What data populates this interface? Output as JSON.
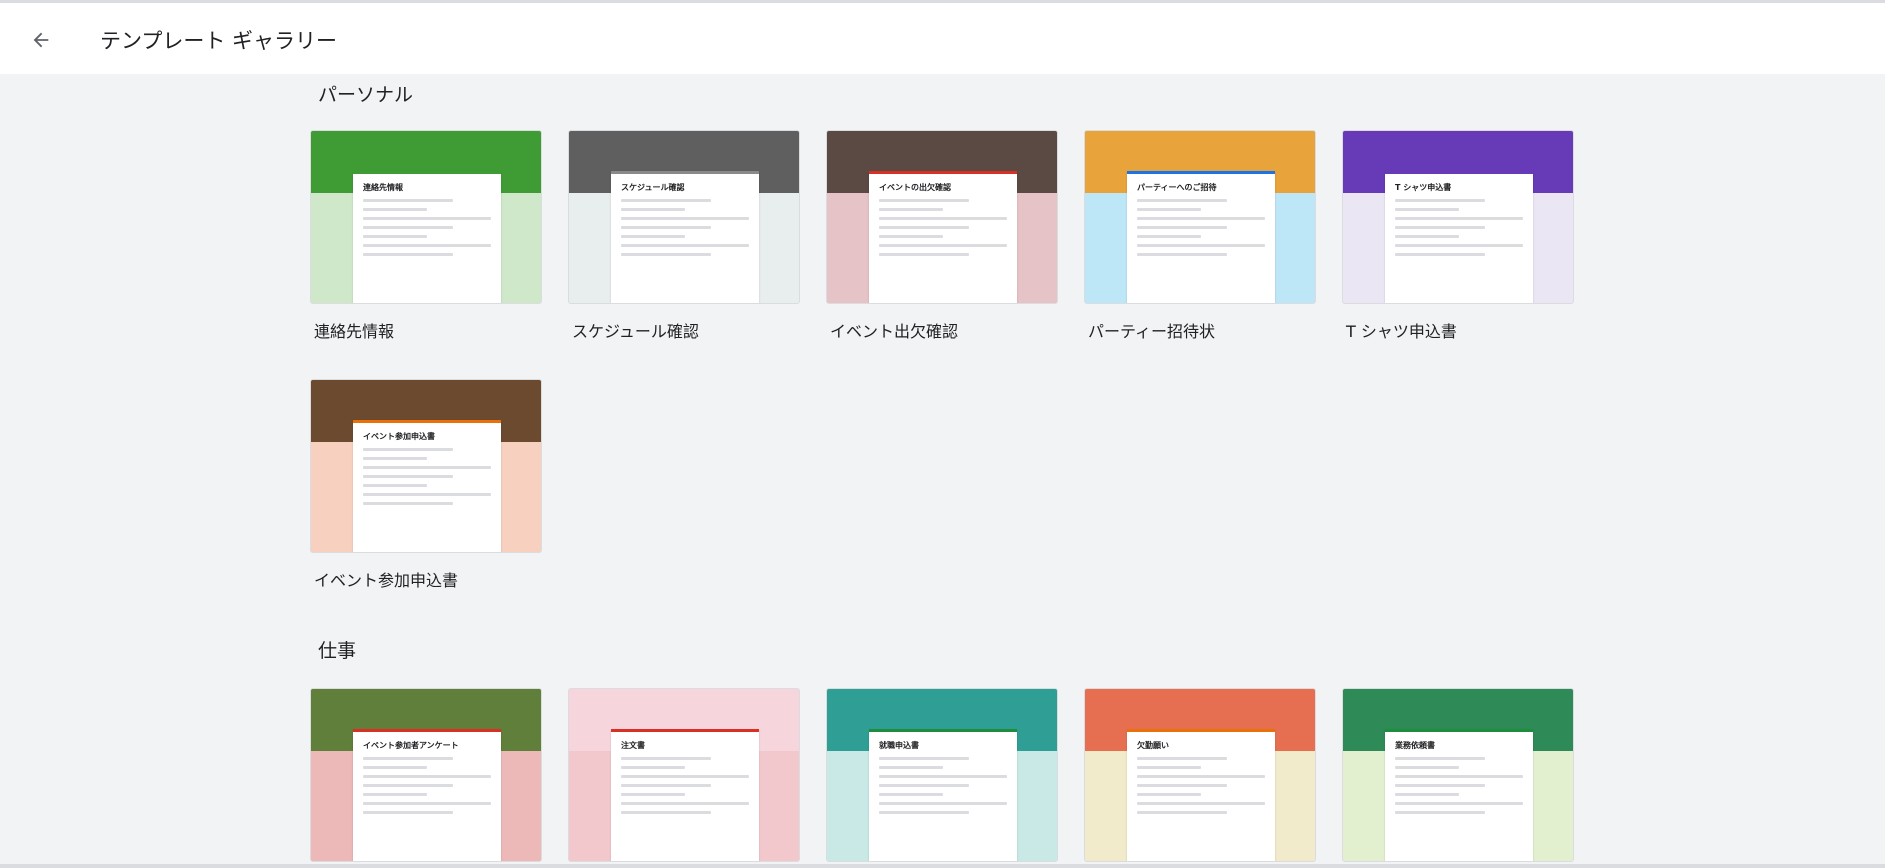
{
  "header": {
    "back_icon": "arrow-left-icon",
    "title": "テンプレート ギャラリー"
  },
  "sections": [
    {
      "title": "パーソナル",
      "templates": [
        {
          "label": "連絡先情報",
          "preview_title": "連絡先情報",
          "band_color": "#3f9c35",
          "bg_color": "#cfe8c9",
          "accent": "#3f9c35"
        },
        {
          "label": "スケジュール確認",
          "preview_title": "スケジュール確認",
          "band_color": "#5f5f5f",
          "bg_color": "#e8eded",
          "accent": "#8a8a8a"
        },
        {
          "label": "イベント出欠確認",
          "preview_title": "イベントの出欠確認",
          "band_color": "#5b4a44",
          "bg_color": "#e6c3c6",
          "accent": "#d93025"
        },
        {
          "label": "パーティー招待状",
          "preview_title": "パーティーへのご招待",
          "band_color": "#e8a33a",
          "bg_color": "#bde6f7",
          "accent": "#1a73e8"
        },
        {
          "label": "T シャツ申込書",
          "preview_title": "T シャツ申込書",
          "band_color": "#673ab7",
          "bg_color": "#ebe6f4",
          "accent": "#673ab7"
        }
      ]
    },
    {
      "title": "",
      "templates": [
        {
          "label": "イベント参加申込書",
          "preview_title": "イベント参加申込書",
          "band_color": "#6b4a30",
          "bg_color": "#f8d0bf",
          "accent": "#e8710a"
        }
      ]
    },
    {
      "title": "仕事",
      "templates": [
        {
          "label": "",
          "preview_title": "イベント参加者アンケート",
          "band_color": "#5f7f3a",
          "bg_color": "#ecb8b8",
          "accent": "#d93025"
        },
        {
          "label": "",
          "preview_title": "注文書",
          "band_color": "#f6d6dc",
          "bg_color": "#f3c8cc",
          "accent": "#d93025"
        },
        {
          "label": "",
          "preview_title": "就職申込書",
          "band_color": "#2f9f95",
          "bg_color": "#c9e9e6",
          "accent": "#1e8e3e"
        },
        {
          "label": "",
          "preview_title": "欠勤願い",
          "band_color": "#e76f51",
          "bg_color": "#f1eacb",
          "accent": "#e8710a"
        },
        {
          "label": "",
          "preview_title": "業務依頼書",
          "band_color": "#2e8b57",
          "bg_color": "#e2f0cf",
          "accent": "#1e8e3e"
        }
      ]
    }
  ]
}
